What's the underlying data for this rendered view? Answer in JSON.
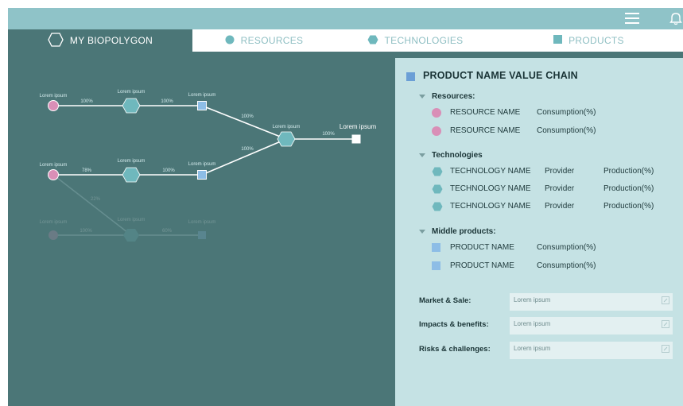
{
  "tabs": [
    {
      "label": "MY BIOPOLYGON",
      "icon": "hexagon-outline-icon"
    },
    {
      "label": "RESOURCES",
      "icon": "circle-icon"
    },
    {
      "label": "TECHNOLOGIES",
      "icon": "hexagon-icon"
    },
    {
      "label": "PRODUCTS",
      "icon": "square-icon"
    }
  ],
  "graph": {
    "nodes": {
      "top_resource": "Lorem ipsum",
      "top_tech": "Lorem ipsum",
      "top_product": "Lorem ipsum",
      "mid_resource": "Lorem ipsum",
      "mid_tech": "Lorem ipsum",
      "mid_product": "Lorem ipsum",
      "join_tech": "Lorem ipsum",
      "final_product": "Lorem ipsum",
      "faded_resource": "Lorem ipsum",
      "faded_tech": "Lorem ipsum",
      "faded_product": "Lorem ipsum"
    },
    "edges": {
      "top_1": "100%",
      "top_2": "100%",
      "top_3": "100%",
      "mid_1": "78%",
      "mid_2": "100%",
      "mid_3": "100%",
      "final": "100%",
      "diag": "22%",
      "faded_1": "100%",
      "faded_2": "60%"
    }
  },
  "panel": {
    "title": "PRODUCT NAME VALUE CHAIN",
    "resources_label": "Resources:",
    "resources": [
      {
        "name": "RESOURCE NAME",
        "metric": "Consumption(%)"
      },
      {
        "name": "RESOURCE NAME",
        "metric": "Consumption(%)"
      }
    ],
    "technologies_label": "Technologies",
    "technologies": [
      {
        "name": "TECHNOLOGY NAME",
        "provider": "Provider",
        "metric": "Production(%)"
      },
      {
        "name": "TECHNOLOGY NAME",
        "provider": "Provider",
        "metric": "Production(%)"
      },
      {
        "name": "TECHNOLOGY NAME",
        "provider": "Provider",
        "metric": "Production(%)"
      }
    ],
    "middle_label": "Middle products:",
    "middle": [
      {
        "name": "PRODUCT NAME",
        "metric": "Consumption(%)"
      },
      {
        "name": "PRODUCT NAME",
        "metric": "Consumption(%)"
      }
    ],
    "fields": [
      {
        "label": "Market & Sale:",
        "value": "Lorem ipsum"
      },
      {
        "label": "Impacts & benefits:",
        "value": "Lorem ipsum"
      },
      {
        "label": "Risks & challenges:",
        "value": "Lorem ipsum"
      }
    ]
  },
  "colors": {
    "resource": "#d98fb7",
    "technology": "#6fb8bd",
    "product": "#8dbde6",
    "background": "#4b7677",
    "panel": "#c5e2e4",
    "topbar": "#8fc3c8"
  }
}
